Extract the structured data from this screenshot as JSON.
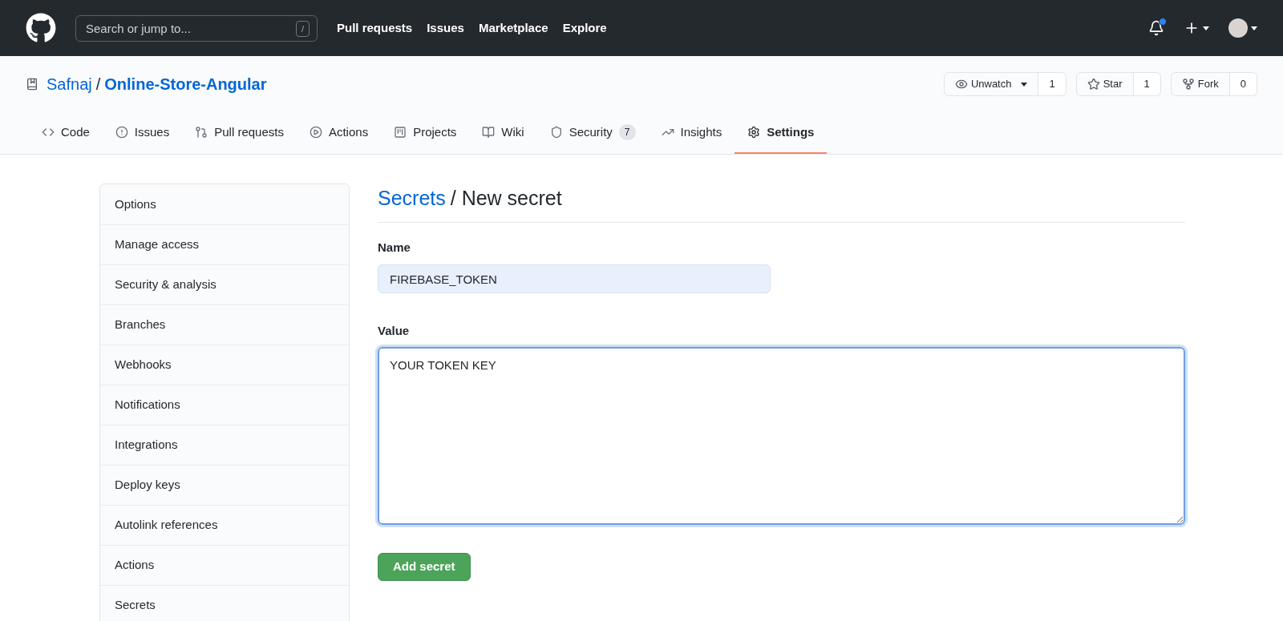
{
  "header": {
    "search": {
      "placeholder": "Search or jump to...",
      "shortcut": "/"
    },
    "nav": [
      "Pull requests",
      "Issues",
      "Marketplace",
      "Explore"
    ],
    "notifications_unread": true
  },
  "repo": {
    "owner": "Safnaj",
    "separator": "/",
    "name": "Online-Store-Angular",
    "actions": [
      {
        "kind": "watch",
        "label": "Unwatch",
        "count": "1"
      },
      {
        "kind": "star",
        "label": "Star",
        "count": "1"
      },
      {
        "kind": "fork",
        "label": "Fork",
        "count": "0"
      }
    ]
  },
  "tabs": [
    {
      "kind": "code",
      "label": "Code",
      "selected": false
    },
    {
      "kind": "issues",
      "label": "Issues",
      "selected": false
    },
    {
      "kind": "pulls",
      "label": "Pull requests",
      "selected": false
    },
    {
      "kind": "actions",
      "label": "Actions",
      "selected": false
    },
    {
      "kind": "projects",
      "label": "Projects",
      "selected": false
    },
    {
      "kind": "wiki",
      "label": "Wiki",
      "selected": false
    },
    {
      "kind": "security",
      "label": "Security",
      "count": "7",
      "selected": false
    },
    {
      "kind": "insights",
      "label": "Insights",
      "selected": false
    },
    {
      "kind": "settings",
      "label": "Settings",
      "selected": true
    }
  ],
  "sidebar": {
    "items": [
      "Options",
      "Manage access",
      "Security & analysis",
      "Branches",
      "Webhooks",
      "Notifications",
      "Integrations",
      "Deploy keys",
      "Autolink references",
      "Actions",
      "Secrets"
    ]
  },
  "form": {
    "breadcrumb_link": "Secrets",
    "breadcrumb_rest": "/ New secret",
    "name_label": "Name",
    "name_value": "FIREBASE_TOKEN",
    "value_label": "Value",
    "value_value": "YOUR TOKEN KEY",
    "submit": "Add secret"
  }
}
